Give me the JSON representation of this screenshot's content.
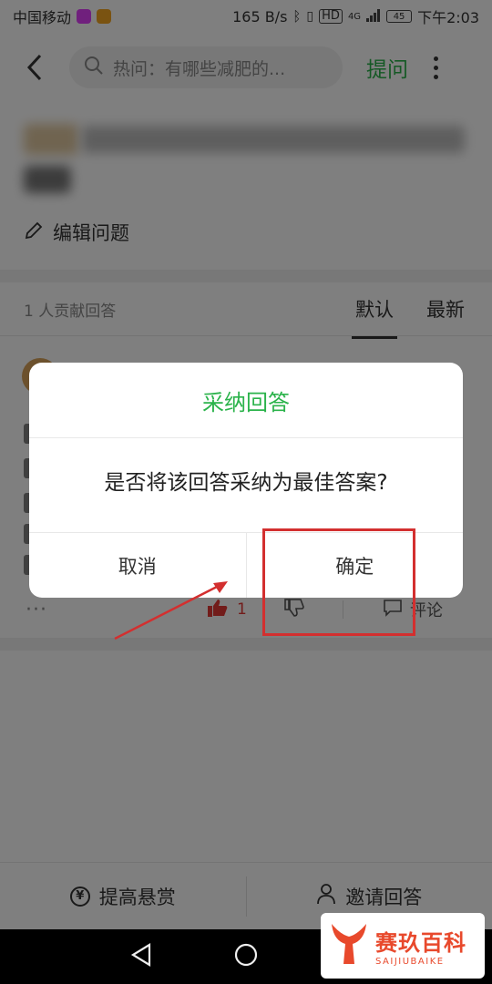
{
  "status_bar": {
    "carrier": "中国移动",
    "speed": "165 B/s",
    "hd": "HD",
    "network": "4G",
    "battery": "45",
    "time": "下午2:03"
  },
  "top_bar": {
    "search_text": "热问：有哪些减肥的...",
    "ask_label": "提问"
  },
  "question": {
    "edit_label": "编辑问题"
  },
  "answers": {
    "count_label": "1 人贡献回答",
    "tabs": [
      "默认",
      "最新"
    ],
    "active_tab": 0,
    "like_count": "1",
    "comment_label": "评论"
  },
  "bottom_bar": {
    "raise_reward": "提高悬赏",
    "invite_answer": "邀请回答",
    "yen_symbol": "¥"
  },
  "dialog": {
    "title": "采纳回答",
    "message": "是否将该回答采纳为最佳答案?",
    "cancel": "取消",
    "confirm": "确定"
  },
  "watermark": {
    "cn": "赛玖百科",
    "en": "SAIJIUBAIKE"
  },
  "colors": {
    "accent_green": "#2bb34b",
    "annotation_red": "#d32f2f",
    "like_red": "#e53935",
    "watermark_orange": "#e8492c"
  }
}
